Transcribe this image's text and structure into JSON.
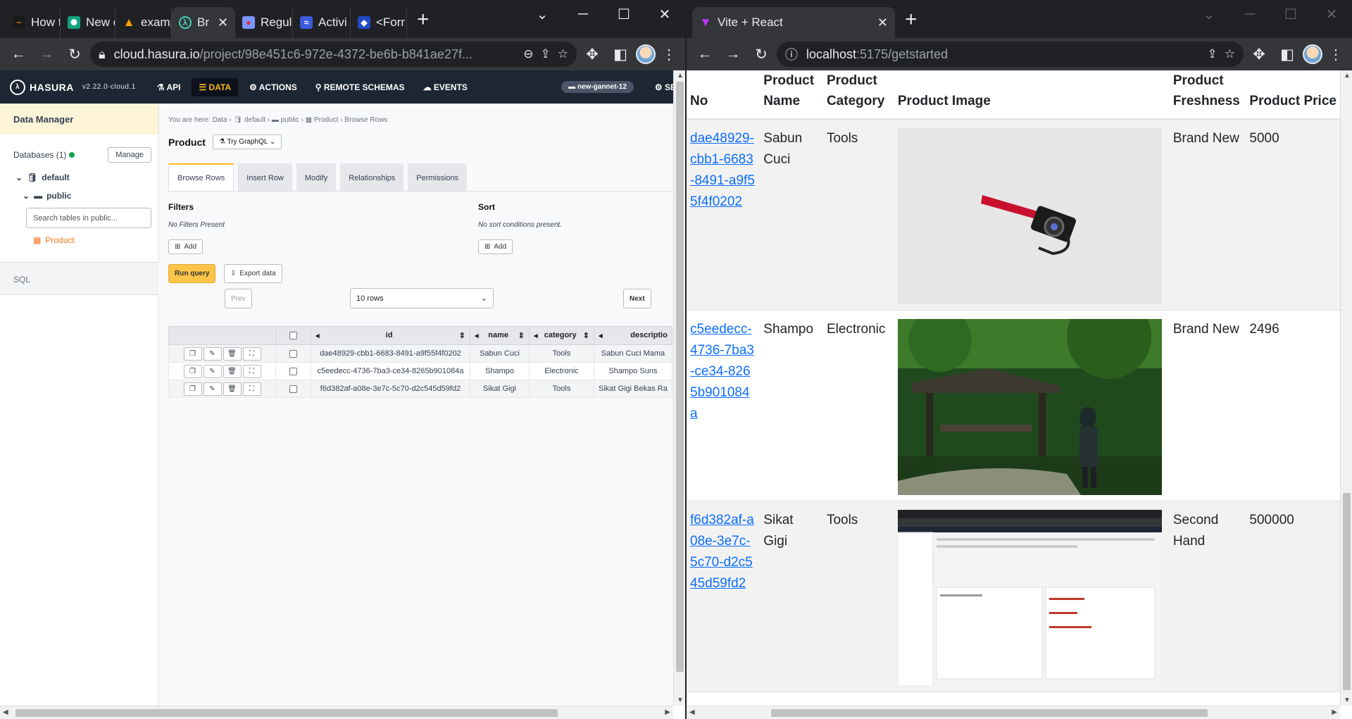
{
  "left_browser": {
    "tabs": [
      {
        "label": "How t",
        "icon": "scribble-icon"
      },
      {
        "label": "New c",
        "icon": "chatgpt-icon"
      },
      {
        "label": "examp",
        "icon": "firebase-icon"
      },
      {
        "label": "Br",
        "icon": "hasura-icon",
        "active": true
      },
      {
        "label": "Regul",
        "icon": "regex-icon"
      },
      {
        "label": "Activi",
        "icon": "activity-icon"
      },
      {
        "label": "<Forr",
        "icon": "formik-icon"
      }
    ],
    "address": {
      "host": "cloud.hasura.io",
      "path": "/project/98e451c6-972e-4372-be6b-b841ae27f..."
    }
  },
  "hasura": {
    "brand": "HASURA",
    "version": "v2.22.0-cloud.1",
    "nav": [
      "API",
      "DATA",
      "ACTIONS",
      "REMOTE SCHEMAS",
      "EVENTS"
    ],
    "active_nav": "DATA",
    "project": "new-gannet-12",
    "settings": "SE",
    "sidebar": {
      "title": "Data Manager",
      "databases": "Databases (1)",
      "manage": "Manage",
      "db": "default",
      "schema": "public",
      "search_placeholder": "Search tables in public...",
      "table": "Product",
      "sql": "SQL"
    },
    "breadcrumb": {
      "prefix": "You are here:",
      "items": [
        "Data",
        "default",
        "public",
        "Product",
        "Browse Rows"
      ]
    },
    "page_title": "Product",
    "try_graphql": "Try GraphQL",
    "tabs": [
      "Browse Rows",
      "Insert Row",
      "Modify",
      "Relationships",
      "Permissions"
    ],
    "filters": {
      "label": "Filters",
      "empty": "No Filters Present",
      "add": "Add"
    },
    "sort": {
      "label": "Sort",
      "empty": "No sort conditions present.",
      "add": "Add"
    },
    "run_query": "Run query",
    "export": "Export data",
    "prev": "Prev",
    "next": "Next",
    "rows_select": "10 rows",
    "columns": [
      "id",
      "name",
      "category",
      "descriptio"
    ],
    "rows": [
      {
        "id": "dae48929-cbb1-6683-8491-a9f55f4f0202",
        "name": "Sabun Cuci",
        "category": "Tools",
        "description": "Sabun Cuci Mama"
      },
      {
        "id": "c5eedecc-4736-7ba3-ce34-8265b901084a",
        "name": "Shampo",
        "category": "Electronic",
        "description": "Shampo Suns"
      },
      {
        "id": "f6d382af-a08e-3e7c-5c70-d2c545d59fd2",
        "name": "Sikat Gigi",
        "category": "Tools",
        "description": "Sikat Gigi Bekas Ra"
      }
    ]
  },
  "right_browser": {
    "tab_title": "Vite + React",
    "address": {
      "host": "localhost",
      "path": ":5175/getstarted"
    },
    "headers": [
      "No",
      "Product Name",
      "Product Category",
      "Product Image",
      "Product Freshness",
      "Product Price"
    ],
    "rows": [
      {
        "id": "dae48929-cbb1-6683-8491-a9f55f4f0202",
        "name": "Sabun Cuci",
        "category": "Tools",
        "image": "camera-photo",
        "freshness": "Brand New",
        "price": "5000"
      },
      {
        "id": "c5eedecc-4736-7ba3-ce34-8265b901084a",
        "name": "Shampo",
        "category": "Electronic",
        "image": "anime-forest-gazebo",
        "freshness": "Brand New",
        "price": "2496"
      },
      {
        "id": "f6d382af-a08e-3e7c-5c70-d2c545d59fd2",
        "name": "Sikat Gigi",
        "category": "Tools",
        "image": "browser-screenshot",
        "freshness": "Second Hand",
        "price": "500000"
      }
    ]
  },
  "colors": {
    "hasura_nav": "#1d2633",
    "hasura_accent": "#ffb61e",
    "link": "#0d6efd",
    "chrome_dark": "#202124"
  }
}
